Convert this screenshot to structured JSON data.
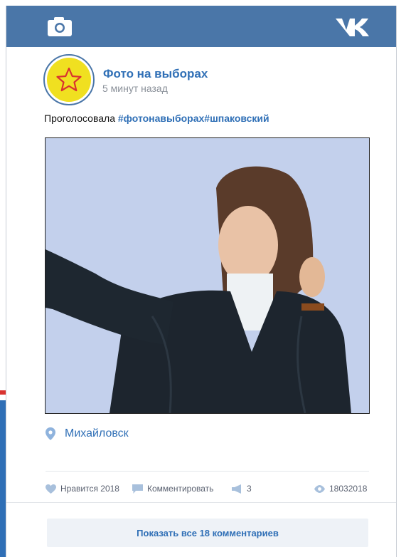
{
  "header": {
    "camera_icon": "camera-icon",
    "logo_icon": "vk-logo-icon"
  },
  "post": {
    "avatar_icon": "star-icon",
    "author": "Фото на выборах",
    "time": "5  минут назад",
    "text_plain": "Проголосовала ",
    "text_tags": "#фотонавыборах#шпаковский",
    "location": "Михайловск"
  },
  "actions": {
    "like_label": "Нравится 2018",
    "comment_label": "Комментировать",
    "share_count": "3",
    "views_count": "18032018"
  },
  "comments": {
    "show_all_label": "Показать все 18 комментариев"
  },
  "colors": {
    "brand": "#4a76a8",
    "link": "#2f6fb6",
    "avatar_fill": "#f0e020",
    "photo_bg": "#c3d0ec"
  }
}
